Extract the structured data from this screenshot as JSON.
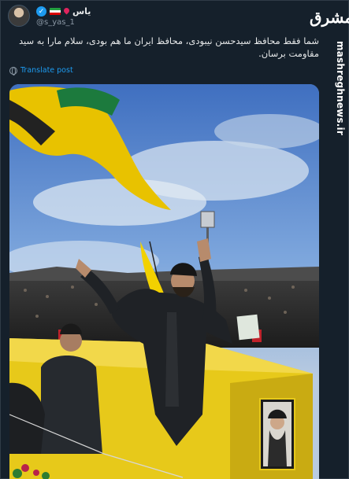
{
  "account": {
    "display_name": "یاس",
    "handle": "@s_yas_1",
    "avatar_icon": "avatar-photo",
    "verified_icon": "verified-badge-icon",
    "badge_icons": [
      "location-pin-icon",
      "iran-flag-icon"
    ]
  },
  "tweet": {
    "text": "شما فقط محافظ سیدحسن نیبودی، محافظ ایران ما هم بودی، سلام مارا به سید مقاومت برسان.",
    "translate_label": "Translate post",
    "translate_icon": "globe-icon"
  },
  "watermark": {
    "logo_text": "مشرق",
    "url": "mashreghnews.ir"
  },
  "photo": {
    "description_icon": "funeral-crowd-photo"
  },
  "colors": {
    "background": "#15202b",
    "link": "#1d9bf0",
    "verified": "#1d9bf0",
    "secondary_text": "#8b98a5",
    "flag_yellow": "#f2d100"
  }
}
